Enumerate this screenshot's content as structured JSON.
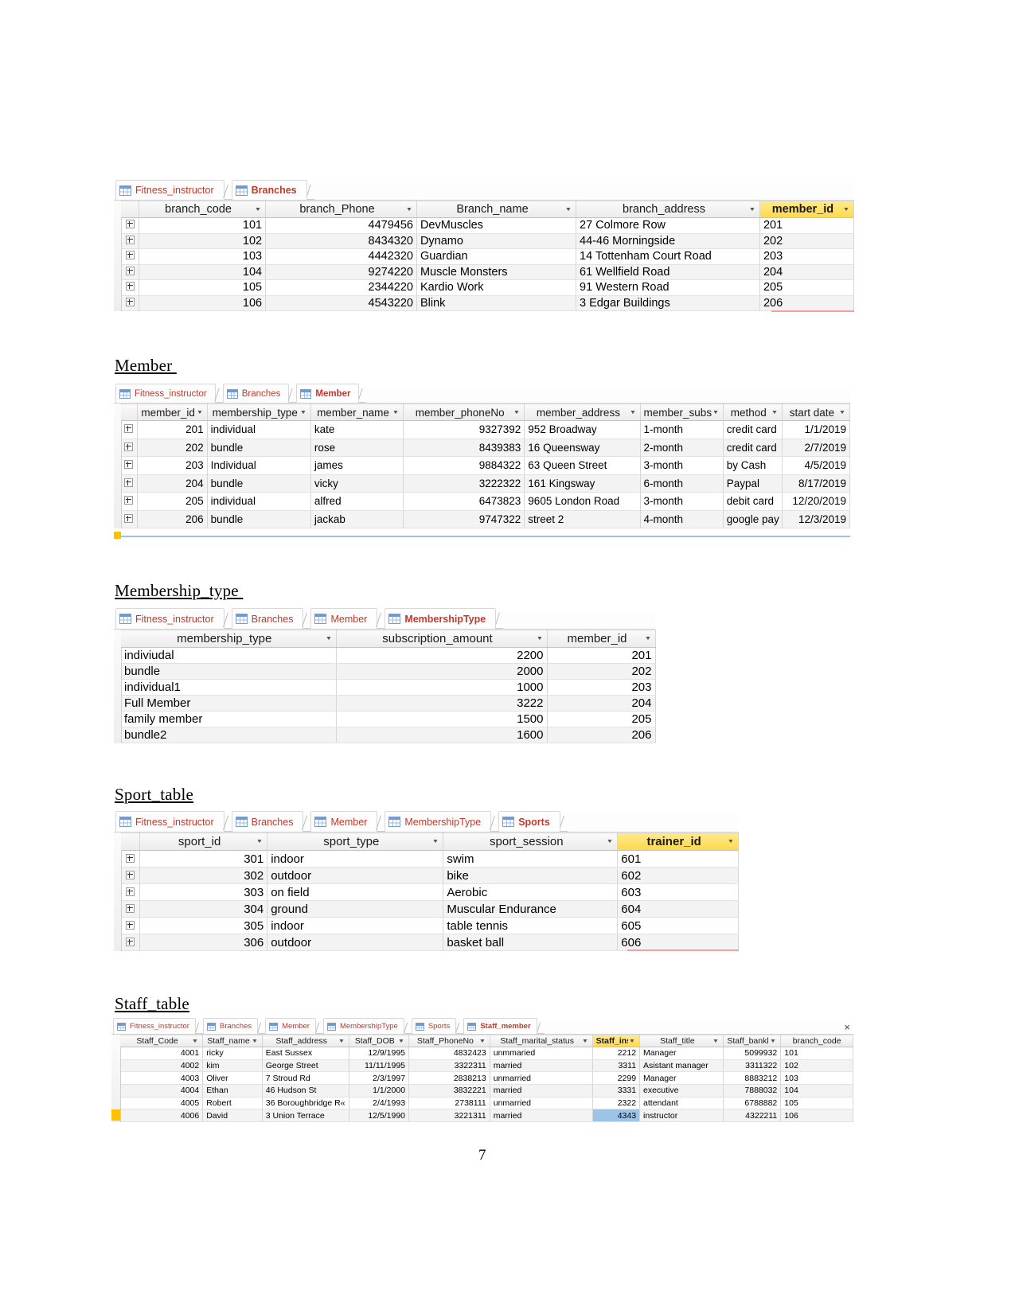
{
  "page": {
    "number": "7"
  },
  "sections": {
    "member_title": "Member ",
    "membership_title": "Membership_type ",
    "sport_title": "Sport_table",
    "staff_title": "Staff_table"
  },
  "colors": {
    "selected_header": "#ffd84d",
    "tab_text": "#c0392b",
    "accent_red_line": "#f0a0a0",
    "accent_blue_line": "#9dc3e6",
    "accent_gold": "#ffc000",
    "selected_cell": "#9dc3e6"
  },
  "icons": {
    "table": "table-grid-icon",
    "dropdown": "chevron-down-icon",
    "expand": "expand-plus-icon",
    "close": "close-icon"
  },
  "branches_window": {
    "tabs": [
      {
        "label": "Fitness_instructor",
        "active": false
      },
      {
        "label": "Branches",
        "active": true
      }
    ],
    "columns": [
      "branch_code",
      "branch_Phone",
      "Branch_name",
      "branch_address",
      "member_id"
    ],
    "selected_column": "member_id",
    "rows": [
      {
        "branch_code": "101",
        "branch_Phone": "4479456",
        "Branch_name": "DevMuscles",
        "branch_address": "27 Colmore Row",
        "member_id": "201"
      },
      {
        "branch_code": "102",
        "branch_Phone": "8434320",
        "Branch_name": "Dynamo",
        "branch_address": "44-46 Morningside",
        "member_id": "202"
      },
      {
        "branch_code": "103",
        "branch_Phone": "4442320",
        "Branch_name": "Guardian",
        "branch_address": "14 Tottenham Court Road",
        "member_id": "203"
      },
      {
        "branch_code": "104",
        "branch_Phone": "9274220",
        "Branch_name": "Muscle Monsters",
        "branch_address": "61 Wellfield Road",
        "member_id": "204"
      },
      {
        "branch_code": "105",
        "branch_Phone": "2344220",
        "Branch_name": "Kardio Work",
        "branch_address": "91 Western Road",
        "member_id": "205"
      },
      {
        "branch_code": "106",
        "branch_Phone": "4543220",
        "Branch_name": "Blink",
        "branch_address": "3 Edgar Buildings",
        "member_id": "206"
      }
    ]
  },
  "member_window": {
    "tabs": [
      {
        "label": "Fitness_instructor",
        "active": false
      },
      {
        "label": "Branches",
        "active": false
      },
      {
        "label": "Member",
        "active": true
      }
    ],
    "columns": [
      "member_id",
      "membership_type",
      "member_name",
      "member_phoneNo",
      "member_address",
      "member_subscr",
      "method",
      "start date"
    ],
    "rows": [
      {
        "member_id": "201",
        "membership_type": "individual",
        "member_name": "kate",
        "member_phoneNo": "9327392",
        "member_address": "952 Broadway",
        "member_subscr": "1-month",
        "method": "credit card",
        "start_date": "1/1/2019"
      },
      {
        "member_id": "202",
        "membership_type": "bundle",
        "member_name": "rose",
        "member_phoneNo": "8439383",
        "member_address": "16 Queensway",
        "member_subscr": "2-month",
        "method": "credit card",
        "start_date": "2/7/2019"
      },
      {
        "member_id": "203",
        "membership_type": "Individual",
        "member_name": "james",
        "member_phoneNo": "9884322",
        "member_address": "63 Queen Street",
        "member_subscr": "3-month",
        "method": "by Cash",
        "start_date": "4/5/2019"
      },
      {
        "member_id": "204",
        "membership_type": "bundle",
        "member_name": "vicky",
        "member_phoneNo": "3222322",
        "member_address": "161 Kingsway",
        "member_subscr": "6-month",
        "method": "Paypal",
        "start_date": "8/17/2019"
      },
      {
        "member_id": "205",
        "membership_type": "individual",
        "member_name": "alfred",
        "member_phoneNo": "6473823",
        "member_address": "9605 London Road",
        "member_subscr": "3-month",
        "method": "debit card",
        "start_date": "12/20/2019"
      },
      {
        "member_id": "206",
        "membership_type": "bundle",
        "member_name": "jackab",
        "member_phoneNo": "9747322",
        "member_address": "street 2",
        "member_subscr": "4-month",
        "method": "google pay",
        "start_date": "12/3/2019"
      }
    ]
  },
  "membershiptype_window": {
    "tabs": [
      {
        "label": "Fitness_instructor",
        "active": false
      },
      {
        "label": "Branches",
        "active": false
      },
      {
        "label": "Member",
        "active": false
      },
      {
        "label": "MembershipType",
        "active": true
      }
    ],
    "columns": [
      "membership_type",
      "subscription_amount",
      "member_id"
    ],
    "rows": [
      {
        "membership_type": "indiviudal",
        "subscription_amount": "2200",
        "member_id": "201"
      },
      {
        "membership_type": "bundle",
        "subscription_amount": "2000",
        "member_id": "202"
      },
      {
        "membership_type": "individual1",
        "subscription_amount": "1000",
        "member_id": "203"
      },
      {
        "membership_type": "Full Member",
        "subscription_amount": "3222",
        "member_id": "204"
      },
      {
        "membership_type": "family member",
        "subscription_amount": "1500",
        "member_id": "205"
      },
      {
        "membership_type": "bundle2",
        "subscription_amount": "1600",
        "member_id": "206"
      }
    ]
  },
  "sports_window": {
    "tabs": [
      {
        "label": "Fitness_instructor",
        "active": false
      },
      {
        "label": "Branches",
        "active": false
      },
      {
        "label": "Member",
        "active": false
      },
      {
        "label": "MembershipType",
        "active": false
      },
      {
        "label": "Sports",
        "active": true
      }
    ],
    "columns": [
      "sport_id",
      "sport_type",
      "sport_session",
      "trainer_id"
    ],
    "selected_column": "trainer_id",
    "rows": [
      {
        "sport_id": "301",
        "sport_type": "indoor",
        "sport_session": "swim",
        "trainer_id": "601"
      },
      {
        "sport_id": "302",
        "sport_type": "outdoor",
        "sport_session": "bike",
        "trainer_id": "602"
      },
      {
        "sport_id": "303",
        "sport_type": "on field",
        "sport_session": "Aerobic",
        "trainer_id": "603"
      },
      {
        "sport_id": "304",
        "sport_type": "ground",
        "sport_session": "Muscular Endurance",
        "trainer_id": "604"
      },
      {
        "sport_id": "305",
        "sport_type": "indoor",
        "sport_session": "table tennis",
        "trainer_id": "605"
      },
      {
        "sport_id": "306",
        "sport_type": "outdoor",
        "sport_session": "basket ball",
        "trainer_id": "606"
      }
    ]
  },
  "staff_window": {
    "tabs": [
      {
        "label": "Fitness_instructor",
        "active": false
      },
      {
        "label": "Branches",
        "active": false
      },
      {
        "label": "Member",
        "active": false
      },
      {
        "label": "MembershipType",
        "active": false
      },
      {
        "label": "Sports",
        "active": false
      },
      {
        "label": "Staff_member",
        "active": true
      }
    ],
    "close_label": "×",
    "columns": [
      "Staff_Code",
      "Staff_name",
      "Staff_address",
      "Staff_DOB",
      "Staff_PhoneNo",
      "Staff_marital_status",
      "Staff_ins",
      "Staff_title",
      "Staff_bankl",
      "branch_code"
    ],
    "selected_column": "Staff_ins",
    "rows": [
      {
        "Staff_Code": "4001",
        "Staff_name": "ricky",
        "Staff_address": "East Sussex",
        "Staff_DOB": "12/9/1995",
        "Staff_PhoneNo": "4832423",
        "Staff_marital_status": "unmmaried",
        "Staff_ins": "2212",
        "Staff_title": "Manager",
        "Staff_bankl": "5099932",
        "branch_code": "101"
      },
      {
        "Staff_Code": "4002",
        "Staff_name": "kim",
        "Staff_address": "George Street",
        "Staff_DOB": "11/11/1995",
        "Staff_PhoneNo": "3322311",
        "Staff_marital_status": "married",
        "Staff_ins": "3311",
        "Staff_title": "Asistant manager",
        "Staff_bankl": "3311322",
        "branch_code": "102"
      },
      {
        "Staff_Code": "4003",
        "Staff_name": "Oliver",
        "Staff_address": "7 Stroud Rd",
        "Staff_DOB": "2/3/1997",
        "Staff_PhoneNo": "2838213",
        "Staff_marital_status": "unmarried",
        "Staff_ins": "2299",
        "Staff_title": "Manager",
        "Staff_bankl": "8883212",
        "branch_code": "103"
      },
      {
        "Staff_Code": "4004",
        "Staff_name": "Ethan",
        "Staff_address": "46 Hudson St",
        "Staff_DOB": "1/1/2000",
        "Staff_PhoneNo": "3832221",
        "Staff_marital_status": "married",
        "Staff_ins": "3331",
        "Staff_title": "executive",
        "Staff_bankl": "7888032",
        "branch_code": "104"
      },
      {
        "Staff_Code": "4005",
        "Staff_name": "Robert",
        "Staff_address": "36 Boroughbridge R«",
        "Staff_DOB": "2/4/1993",
        "Staff_PhoneNo": "2738111",
        "Staff_marital_status": "unmarried",
        "Staff_ins": "2322",
        "Staff_title": "attendant",
        "Staff_bankl": "6788882",
        "branch_code": "105"
      },
      {
        "Staff_Code": "4006",
        "Staff_name": "David",
        "Staff_address": "3 Union Terrace",
        "Staff_DOB": "12/5/1990",
        "Staff_PhoneNo": "3221311",
        "Staff_marital_status": "married",
        "Staff_ins": "4343",
        "Staff_title": "instructor",
        "Staff_bankl": "4322211",
        "branch_code": "106"
      }
    ],
    "selected_cell_row": 5
  }
}
